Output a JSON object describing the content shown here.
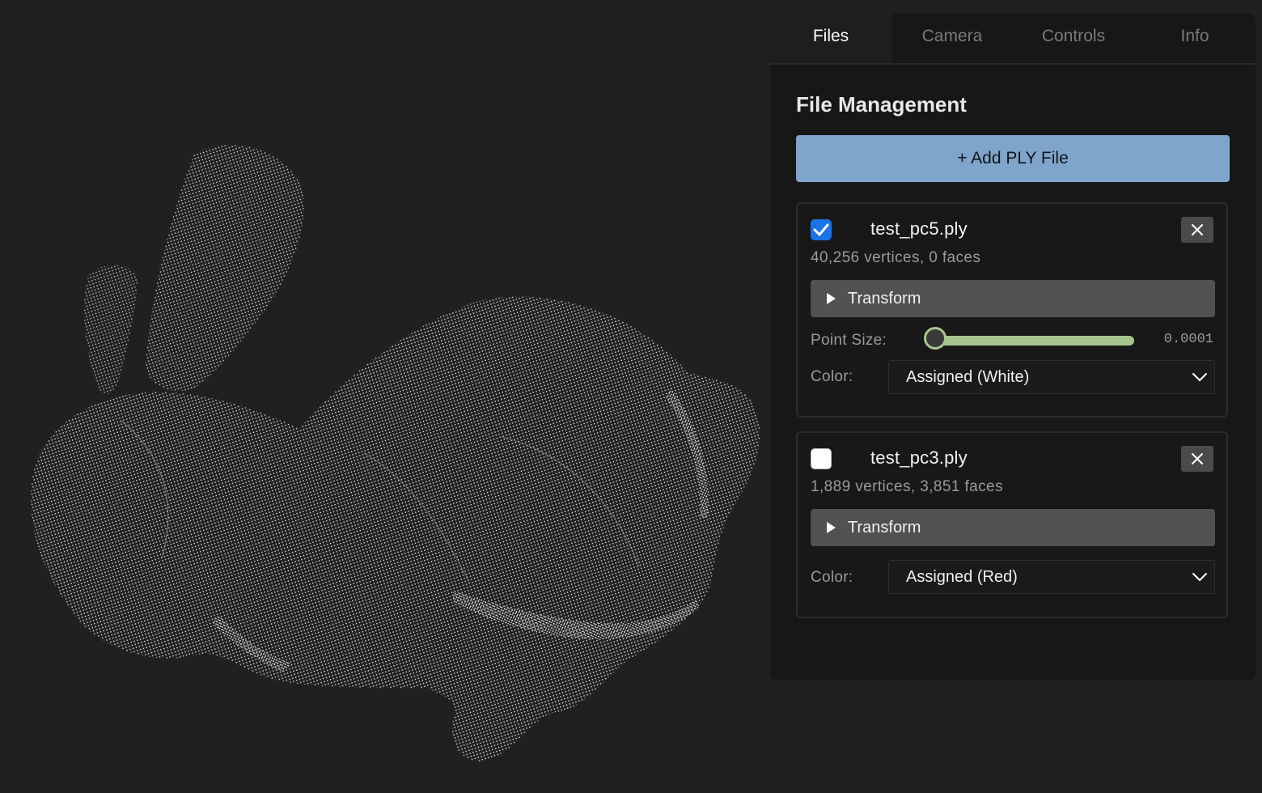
{
  "tabs": [
    {
      "label": "Files"
    },
    {
      "label": "Camera"
    },
    {
      "label": "Controls"
    },
    {
      "label": "Info"
    }
  ],
  "active_tab": "Files",
  "section_title": "File Management",
  "add_button_label": "+ Add PLY File",
  "files": [
    {
      "name": "test_pc5.ply",
      "meta": "40,256 vertices, 0 faces",
      "visible": true,
      "transform_label": "Transform",
      "point_size_label": "Point Size:",
      "point_size_value": "0.0001",
      "point_size_fraction": 0.0,
      "color_label": "Color:",
      "color_value": "Assigned (White)"
    },
    {
      "name": "test_pc3.ply",
      "meta": "1,889 vertices, 3,851 faces",
      "visible": false,
      "transform_label": "Transform",
      "color_label": "Color:",
      "color_value": "Assigned (Red)"
    }
  ],
  "colors": {
    "background": "#202020",
    "panel": "#171717",
    "accent_button": "#80a5cc",
    "slider": "#a8c590",
    "checkbox_on": "#1a73e8",
    "point_cloud": "#e8e8e8"
  },
  "icons": {
    "close": "close-icon",
    "check": "checkmark-icon",
    "expand": "triangle-right-icon",
    "dropdown": "chevron-down-icon"
  }
}
